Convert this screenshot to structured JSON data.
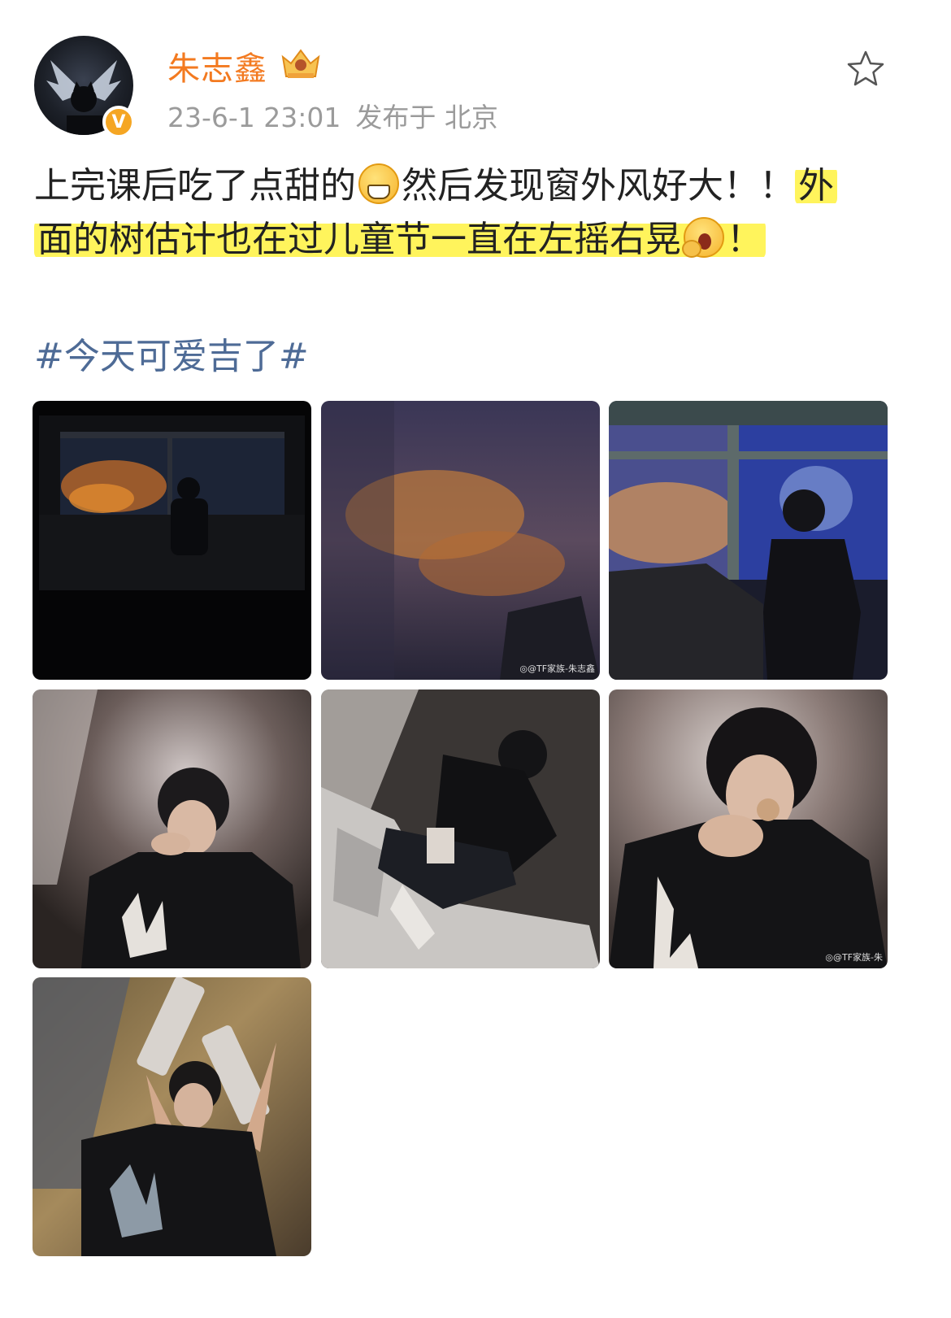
{
  "post": {
    "author": "朱志鑫",
    "date": "23-6-1 23:01",
    "location": "发布于 北京",
    "text": {
      "part1": "上完课后吃了点甜的",
      "part2": "然后发现窗外风好大！！",
      "highlight1": "外",
      "highlight2": "面的树估计也在过儿童节一直在左摇右晃",
      "end": "！"
    },
    "hashtag": "#今天可爱吉了#"
  },
  "icons": {
    "verified_badge": "v-badge",
    "vip_badge": "crown-icon",
    "favorite": "star-icon",
    "emoji1": "grin-emoji",
    "emoji2": "yawn-emoji"
  },
  "photos": [
    {
      "name": "photo-1",
      "watermark": ""
    },
    {
      "name": "photo-2",
      "watermark": "◎@TF家族-朱志鑫"
    },
    {
      "name": "photo-3",
      "watermark": ""
    },
    {
      "name": "photo-4",
      "watermark": ""
    },
    {
      "name": "photo-5",
      "watermark": ""
    },
    {
      "name": "photo-6",
      "watermark": "◎@TF家族-朱"
    },
    {
      "name": "photo-7",
      "watermark": ""
    }
  ],
  "colors": {
    "username": "#f37a20",
    "meta": "#9b9b9b",
    "hashtag": "#4e6b96",
    "highlight": "#fff45c",
    "verified": "#f5a623"
  }
}
